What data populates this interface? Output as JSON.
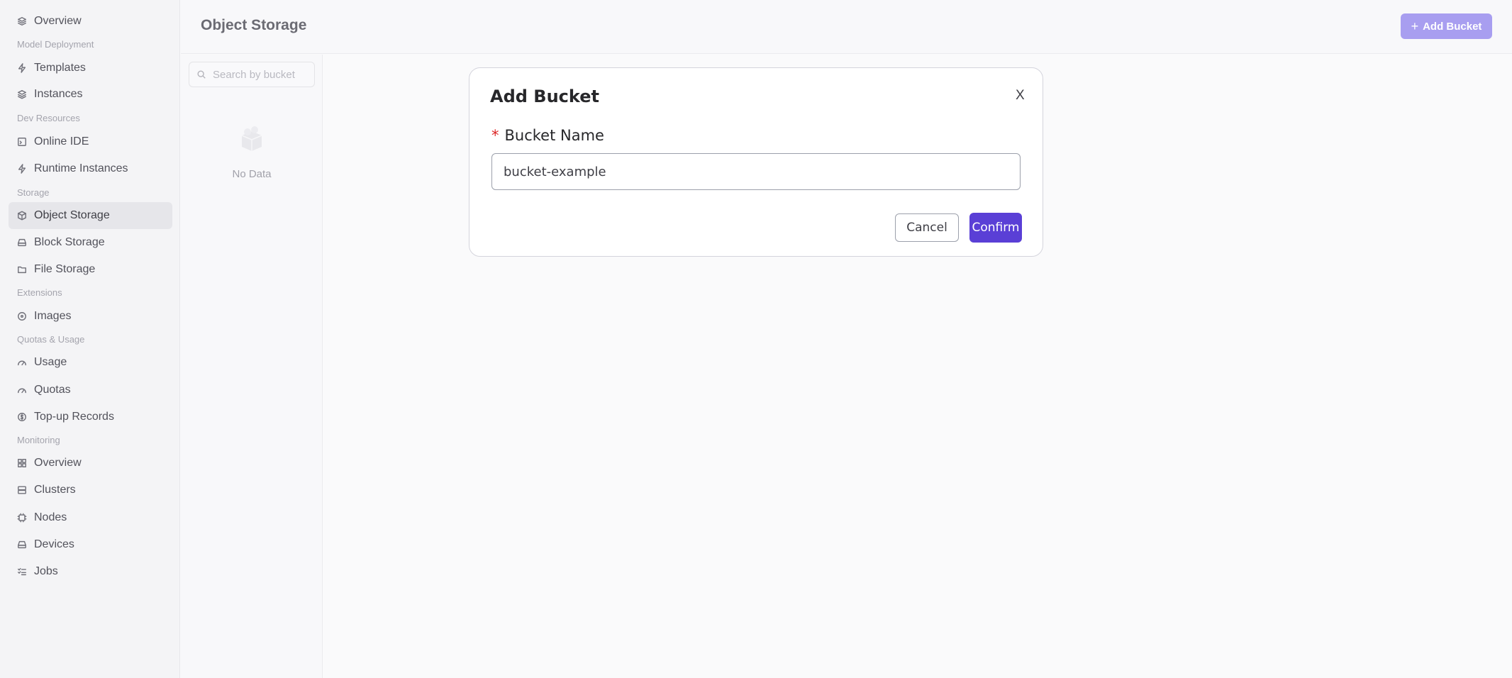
{
  "sidebar": {
    "groups": [
      "Model Deployment",
      "Dev Resources",
      "Storage",
      "Extensions",
      "Quotas & Usage",
      "Monitoring"
    ],
    "items": [
      {
        "label": "Overview",
        "icon": "layers-icon"
      },
      {
        "label": "Templates",
        "icon": "bolt-icon"
      },
      {
        "label": "Instances",
        "icon": "stack-icon"
      },
      {
        "label": "Online IDE",
        "icon": "code-window-icon"
      },
      {
        "label": "Runtime Instances",
        "icon": "bolt-icon"
      },
      {
        "label": "Object Storage",
        "icon": "cube-icon"
      },
      {
        "label": "Block Storage",
        "icon": "drive-icon"
      },
      {
        "label": "File Storage",
        "icon": "folder-icon"
      },
      {
        "label": "Images",
        "icon": "disc-icon"
      },
      {
        "label": "Usage",
        "icon": "gauge-icon"
      },
      {
        "label": "Quotas",
        "icon": "gauge-icon"
      },
      {
        "label": "Top-up Records",
        "icon": "dollar-icon"
      },
      {
        "label": "Overview",
        "icon": "dashboard-icon"
      },
      {
        "label": "Clusters",
        "icon": "server-icon"
      },
      {
        "label": "Nodes",
        "icon": "chip-icon"
      },
      {
        "label": "Devices",
        "icon": "drive-icon"
      },
      {
        "label": "Jobs",
        "icon": "list-check-icon"
      }
    ],
    "active_item": "Object Storage"
  },
  "header": {
    "title": "Object Storage",
    "add_button_label": "Add Bucket"
  },
  "list_panel": {
    "search_placeholder": "Search by bucket name",
    "empty_text": "No Data"
  },
  "modal": {
    "title": "Add Bucket",
    "close_label": "X",
    "required_mark": "*",
    "field_label": "Bucket Name",
    "field_value": "bucket-example",
    "cancel_label": "Cancel",
    "confirm_label": "Confirm"
  },
  "colors": {
    "accent": "#5a3fd6",
    "accent_disabled": "#a89ef0",
    "required": "#dc2626"
  }
}
